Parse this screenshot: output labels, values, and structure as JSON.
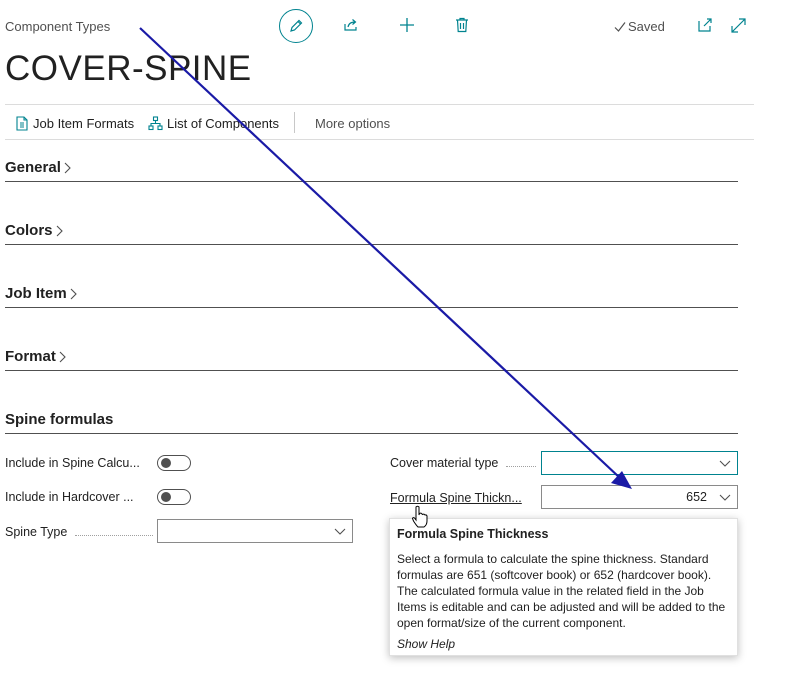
{
  "header": {
    "breadcrumb": "Component Types",
    "title": "COVER-SPINE",
    "saved_label": "Saved"
  },
  "actions": {
    "job_item_formats": "Job Item Formats",
    "list_of_components": "List of Components",
    "more_options": "More options"
  },
  "sections": {
    "general": "General",
    "colors": "Colors",
    "job_item": "Job Item",
    "format": "Format",
    "spine_formulas": "Spine formulas"
  },
  "fields": {
    "include_spine_calc": {
      "label": "Include in Spine Calcu...",
      "value": false
    },
    "include_hardcover": {
      "label": "Include in Hardcover ...",
      "value": false
    },
    "spine_type": {
      "label": "Spine Type",
      "value": ""
    },
    "cover_material_type": {
      "label": "Cover material type",
      "value": ""
    },
    "formula_spine_thickness": {
      "label": "Formula Spine Thickn...",
      "value": "652"
    }
  },
  "tooltip": {
    "title": "Formula Spine Thickness",
    "body": "Select a formula to calculate the spine thickness. Standard formulas are 651 (softcover book) or 652 (hardcover book). The calculated formula value in the related field in the Job Items is editable and can be adjusted and will be added to the open format/size of the current component.",
    "help_link": "Show Help"
  },
  "colors": {
    "accent": "#00838f",
    "annotation_arrow": "#1a1aa6"
  }
}
